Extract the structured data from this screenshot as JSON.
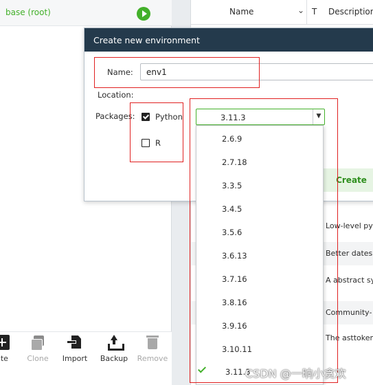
{
  "environments": {
    "selected": "base (root)"
  },
  "toolbar": {
    "create": "ate",
    "clone": "Clone",
    "import": "Import",
    "backup": "Backup",
    "remove": "Remove"
  },
  "packages_table": {
    "columns": {
      "name": "Name",
      "sort_indicator": "⌄",
      "type": "T",
      "description": "Description"
    },
    "descriptions": [
      "Low-level py",
      "Better dates",
      "A abstract sy",
      "Community-",
      "The asttoken"
    ]
  },
  "dialog": {
    "title": "Create new environment",
    "name_label": "Name:",
    "name_value": "env1",
    "location_label": "Location:",
    "packages_label": "Packages:",
    "python_label": "Python",
    "python_checked": true,
    "r_label": "R",
    "r_checked": false,
    "version_selected": "3.11.3",
    "create_label": "Create"
  },
  "version_options": [
    "2.6.9",
    "2.7.18",
    "3.3.5",
    "3.4.5",
    "3.5.6",
    "3.6.13",
    "3.7.16",
    "3.8.16",
    "3.9.16",
    "3.10.11",
    "3.11.3"
  ],
  "watermark": "CSDN @一晌小贪欢",
  "colors": {
    "accent": "#43b02a",
    "title_bar": "#243a4c",
    "annotation": "#e02020"
  }
}
